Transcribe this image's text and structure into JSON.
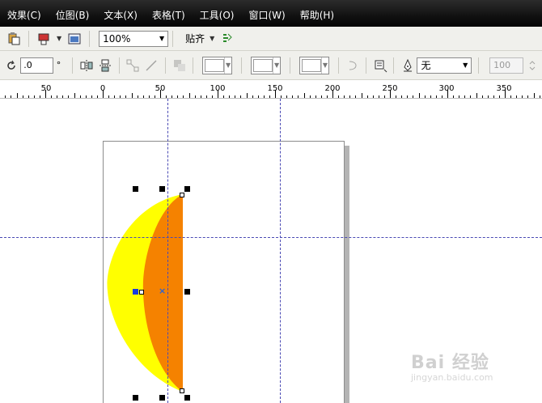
{
  "menu": [
    {
      "label": "效果(C)"
    },
    {
      "label": "位图(B)"
    },
    {
      "label": "文本(X)"
    },
    {
      "label": "表格(T)"
    },
    {
      "label": "工具(O)"
    },
    {
      "label": "窗口(W)"
    },
    {
      "label": "帮助(H)"
    }
  ],
  "toolbar": {
    "zoom_value": "100%",
    "snap_label": "贴齐"
  },
  "property_bar": {
    "rotation_value": ".0",
    "degree_symbol": "°",
    "outline_value": "无",
    "outline_width": "100"
  },
  "ruler": {
    "labels": [
      "50",
      "0",
      "50",
      "100",
      "150",
      "200",
      "250",
      "300",
      "350"
    ]
  },
  "shapes": {
    "outer_color": "#FFFF00",
    "inner_color": "#F58200"
  },
  "watermark": {
    "main": "Bai 经验",
    "sub": "jingyan.baidu.com"
  }
}
